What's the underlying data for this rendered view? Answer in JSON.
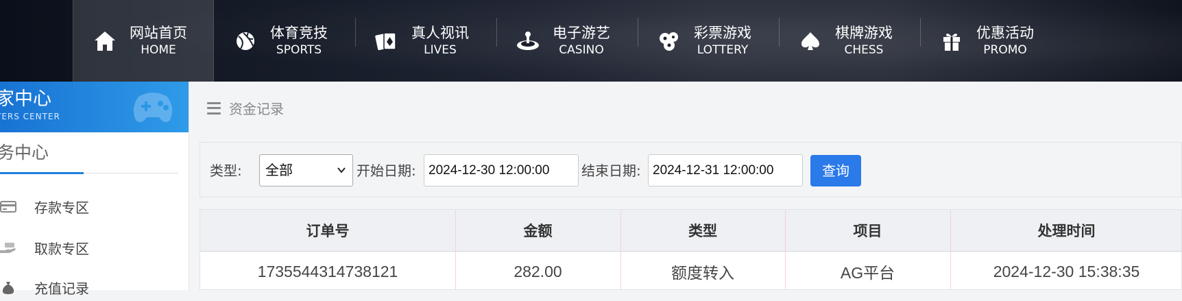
{
  "nav": {
    "items": [
      {
        "cn": "网站首页",
        "en": "HOME",
        "icon": "home-icon",
        "active": true
      },
      {
        "cn": "体育竞技",
        "en": "SPORTS",
        "icon": "ball-icon"
      },
      {
        "cn": "真人视讯",
        "en": "LIVES",
        "icon": "cards-icon"
      },
      {
        "cn": "电子游艺",
        "en": "CASINO",
        "icon": "roulette-icon"
      },
      {
        "cn": "彩票游戏",
        "en": "LOTTERY",
        "icon": "lottery-balls-icon"
      },
      {
        "cn": "棋牌游戏",
        "en": "CHESS",
        "icon": "spade-icon"
      },
      {
        "cn": "优惠活动",
        "en": "PROMO",
        "icon": "gift-icon"
      }
    ]
  },
  "sidebar": {
    "title": "家中心",
    "subtitle": "YERS CENTER",
    "section": "务中心",
    "items": [
      {
        "label": "存款专区",
        "icon": "card-icon"
      },
      {
        "label": "取款专区",
        "icon": "withdraw-hand-icon"
      },
      {
        "label": "充值记录",
        "icon": "money-bag-icon"
      }
    ]
  },
  "breadcrumb": {
    "label": "资金记录",
    "icon": "menu-icon"
  },
  "filter": {
    "type_label": "类型:",
    "type_value": "全部",
    "start_label": "开始日期:",
    "start_value": "2024-12-30 12:00:00",
    "end_label": "结束日期:",
    "end_value": "2024-12-31 12:00:00",
    "query_button": "查询"
  },
  "table": {
    "headers": [
      "订单号",
      "金额",
      "类型",
      "项目",
      "处理时间"
    ],
    "rows": [
      [
        "1735544314738121",
        "282.00",
        "额度转入",
        "AG平台",
        "2024-12-30 15:38:35"
      ]
    ]
  },
  "colors": {
    "accent": "#2a7ae9",
    "sidebar_header": "#1e7fdd"
  }
}
